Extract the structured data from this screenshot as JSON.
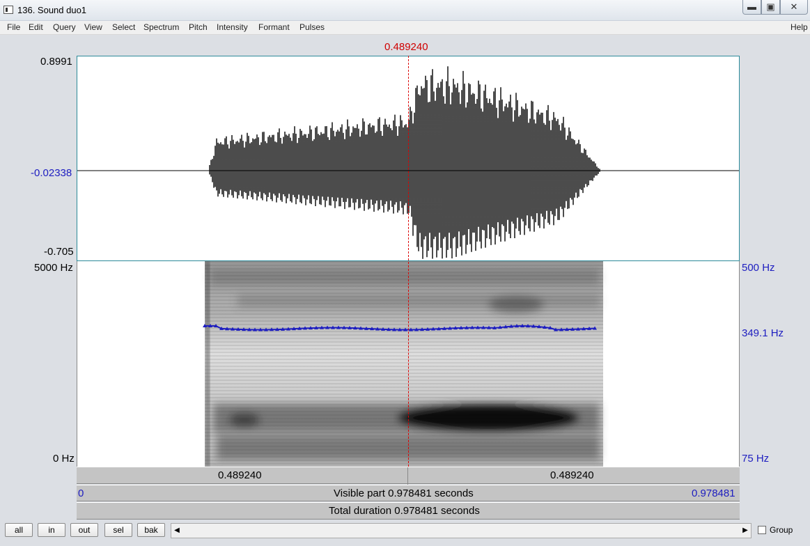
{
  "window": {
    "title": "136. Sound duo1"
  },
  "menu": [
    "File",
    "Edit",
    "Query",
    "View",
    "Select",
    "Spectrum",
    "Pitch",
    "Intensity",
    "Formant",
    "Pulses"
  ],
  "help_label": "Help",
  "cursor_time": "0.489240",
  "waveform": {
    "max": "0.8991",
    "mid": "-0.02338",
    "min": "-0.705"
  },
  "spectrogram": {
    "top_freq": "5000 Hz",
    "bottom_freq": "0 Hz"
  },
  "pitch": {
    "top": "500 Hz",
    "value": "349.1 Hz",
    "bottom": "75 Hz"
  },
  "selection_bar": {
    "left": "0.489240",
    "right": "0.489240"
  },
  "visible_bar": {
    "start": "0",
    "text": "Visible part 0.978481 seconds",
    "end": "0.978481"
  },
  "total_bar": {
    "text": "Total duration 0.978481 seconds"
  },
  "buttons": {
    "all": "all",
    "in": "in",
    "out": "out",
    "sel": "sel",
    "bak": "bak"
  },
  "group_label": "Group",
  "colors": {
    "cursor": "#d00000",
    "pitch_line": "#1d1dc0",
    "waveform": "#000000"
  }
}
